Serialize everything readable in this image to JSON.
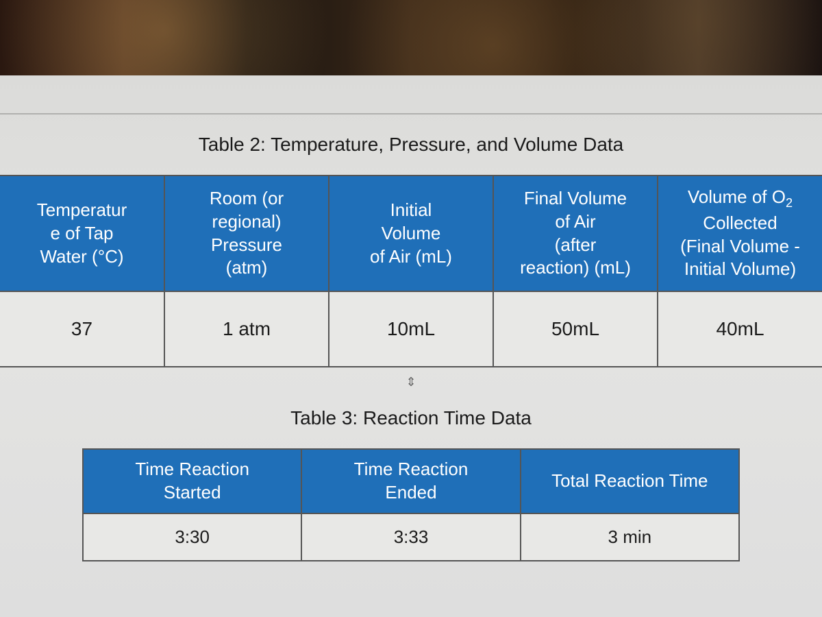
{
  "table2": {
    "caption": "Table 2: Temperature, Pressure, and Volume Data",
    "headers": {
      "col1": "Temperatur\ne of Tap\nWater (°C)",
      "col2": "Room (or regional) Pressure (atm)",
      "col3": "Initial Volume of Air (mL)",
      "col4": "Final Volume of Air (after reaction) (mL)",
      "col5_pre": "Volume of O",
      "col5_sub": "2",
      "col5_post": " Collected (Final Volume - Initial Volume)"
    },
    "row": {
      "temp": "37",
      "pressure": "1 atm",
      "initial_vol": "10mL",
      "final_vol": "50mL",
      "collected": "40mL"
    }
  },
  "table3": {
    "caption": "Table 3: Reaction Time Data",
    "headers": {
      "col1": "Time Reaction Started",
      "col2": "Time Reaction Ended",
      "col3": "Total Reaction Time"
    },
    "row": {
      "started": "3:30",
      "ended": "3:33",
      "total": "3 min"
    }
  },
  "chart_data": [
    {
      "type": "table",
      "title": "Table 2: Temperature, Pressure, and Volume Data",
      "columns": [
        "Temperature of Tap Water (°C)",
        "Room (or regional) Pressure (atm)",
        "Initial Volume of Air (mL)",
        "Final Volume of Air (after reaction) (mL)",
        "Volume of O2 Collected (Final Volume - Initial Volume)"
      ],
      "rows": [
        [
          "37",
          "1 atm",
          "10mL",
          "50mL",
          "40mL"
        ]
      ]
    },
    {
      "type": "table",
      "title": "Table 3: Reaction Time Data",
      "columns": [
        "Time Reaction Started",
        "Time Reaction Ended",
        "Total Reaction Time"
      ],
      "rows": [
        [
          "3:30",
          "3:33",
          "3 min"
        ]
      ]
    }
  ]
}
